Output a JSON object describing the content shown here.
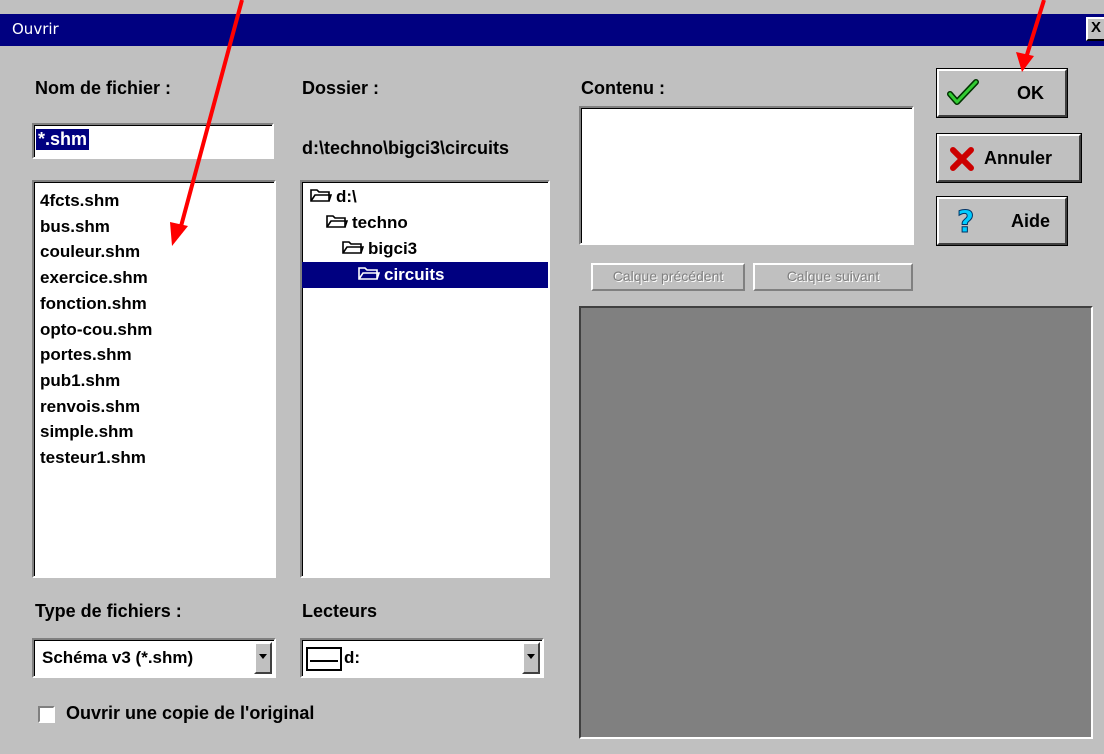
{
  "window": {
    "title": "Ouvrir",
    "close_label": "X"
  },
  "labels": {
    "filename": "Nom de fichier :",
    "folder": "Dossier :",
    "content": "Contenu :",
    "filetype": "Type de fichiers :",
    "drives": "Lecteurs"
  },
  "filename_input": {
    "value": "*.shm"
  },
  "folder_path": "d:\\techno\\bigci3\\circuits",
  "files": [
    "4fcts.shm",
    "bus.shm",
    "couleur.shm",
    "exercice.shm",
    "fonction.shm",
    "opto-cou.shm",
    "portes.shm",
    "pub1.shm",
    "renvois.shm",
    "simple.shm",
    "testeur1.shm"
  ],
  "folders": [
    {
      "label": "d:\\",
      "level": 0,
      "open": true,
      "selected": false
    },
    {
      "label": "techno",
      "level": 1,
      "open": true,
      "selected": false
    },
    {
      "label": "bigci3",
      "level": 2,
      "open": true,
      "selected": false
    },
    {
      "label": "circuits",
      "level": 3,
      "open": true,
      "selected": true
    }
  ],
  "buttons": {
    "ok": "OK",
    "cancel": "Annuler",
    "help": "Aide",
    "prev_layer": "Calque précédent",
    "next_layer": "Calque suivant"
  },
  "filetype_select": {
    "value": "Schéma v3 (*.shm)"
  },
  "drive_select": {
    "value": "d:"
  },
  "copy_checkbox": {
    "label": "Ouvrir une copie de l'original",
    "checked": false
  },
  "colors": {
    "title_bar": "#000080",
    "face": "#c0c0c0",
    "selection": "#000080",
    "preview": "#808080",
    "annotation_arrow": "#ff0000"
  },
  "icons": {
    "ok": "check-icon",
    "cancel": "x-icon",
    "help": "question-icon",
    "folder": "folder-icon",
    "drive": "drive-icon"
  }
}
